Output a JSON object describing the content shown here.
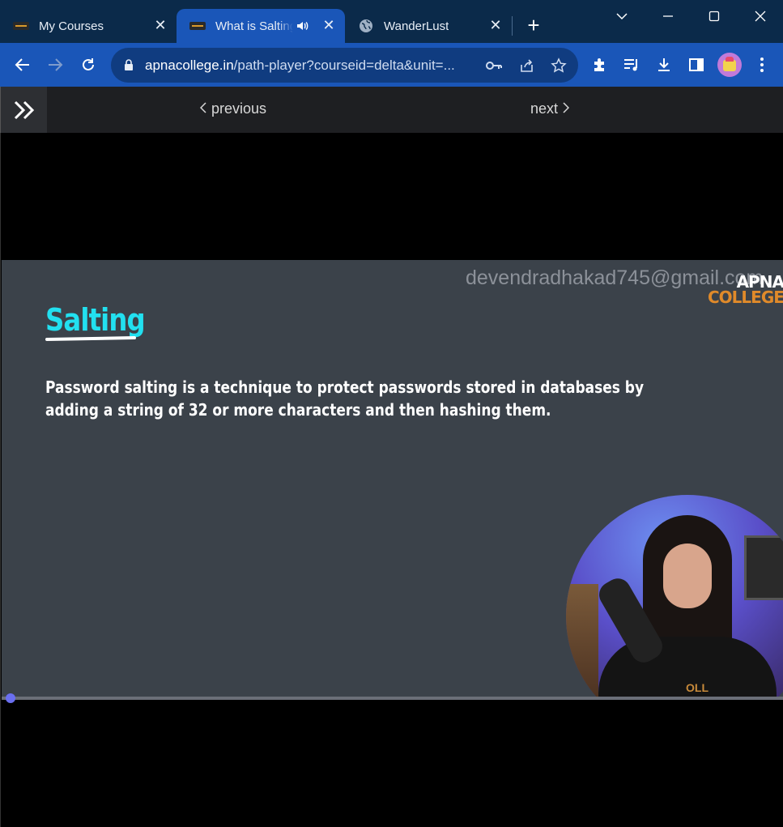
{
  "browser": {
    "tabs": [
      {
        "title": "My Courses",
        "favicon": "college-favicon"
      },
      {
        "title": "What is Salting",
        "favicon": "college-favicon",
        "active": true,
        "audio": true
      },
      {
        "title": "WanderLust",
        "favicon": "globe-icon"
      }
    ],
    "url_host": "apnacollege.in",
    "url_path": "/path-player?courseid=delta&unit=..."
  },
  "pagenav": {
    "previous_label": "previous",
    "next_label": "next"
  },
  "slide": {
    "title": "Salting",
    "body": "Password salting is a technique to protect passwords stored in databases by adding a string of 32 or more characters and then hashing them.",
    "watermark": "devendradhakad745@gmail.com",
    "brand_line1": "APNA",
    "brand_line2": "COLLEGE",
    "presenter_shirt_text": "OLL"
  },
  "video": {
    "progress_fraction": 0.0
  },
  "colors": {
    "tabstrip": "#0b2a4a",
    "toolbar": "#1a56b8",
    "slide_bg": "#3b424a",
    "title_cyan": "#22e0f0",
    "brand_orange": "#e08a2a",
    "progress_knob": "#6a6ff0"
  }
}
